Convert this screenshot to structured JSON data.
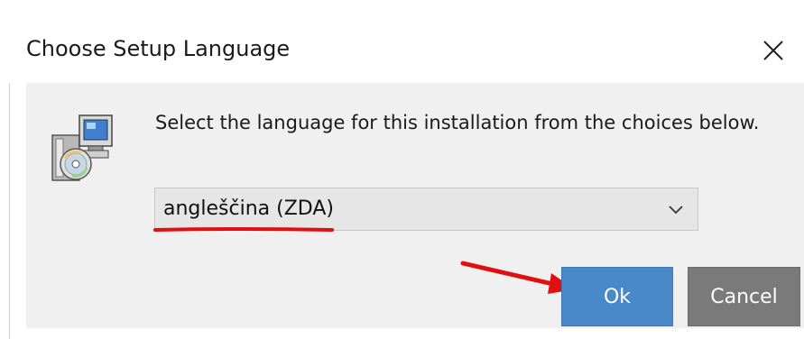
{
  "window": {
    "title": "Choose Setup Language",
    "close_icon": "close-icon"
  },
  "dialog": {
    "icon": "setup-installer-icon",
    "prompt": "Select the language for this installation from the choices below.",
    "language_select": {
      "selected": "angleščina (ZDA)",
      "dropdown_icon": "chevron-down-icon"
    },
    "annotations": {
      "underline_color": "#e01010",
      "arrow_color": "#e01010"
    },
    "buttons": {
      "ok": "Ok",
      "cancel": "Cancel"
    }
  },
  "colors": {
    "ok_button": "#4a89c9",
    "cancel_button": "#7a7a7a",
    "body_background": "#f0f0f0"
  }
}
